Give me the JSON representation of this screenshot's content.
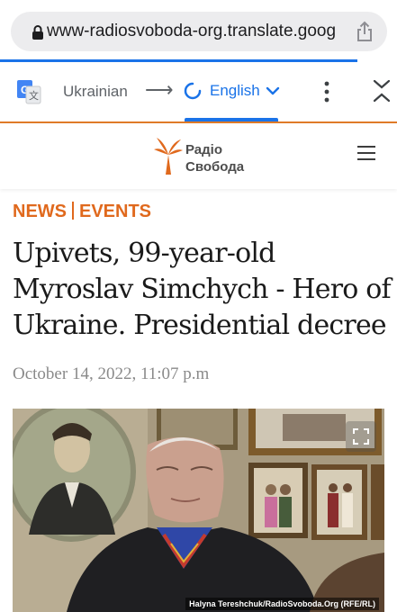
{
  "browser": {
    "url": "www-radiosvoboda-org.translate.goog"
  },
  "translate": {
    "source_language": "Ukrainian",
    "arrow": "⟶",
    "target_language": "English"
  },
  "site": {
    "logo_line1": "Радіо",
    "logo_line2": "Свобода",
    "accent_color": "#e0691d"
  },
  "article": {
    "category_left": "NEWS",
    "category_right": "EVENTS",
    "headline": "Upivets, 99-year-old Myroslav Simchych - Hero of Ukraine. Presidential decree",
    "date": "October 14, 2022, 11:07 p.m",
    "photo_credit": "Halyna Tereshchuk/RadioSvoboda.Org (RFE/RL)"
  },
  "colors": {
    "link_blue": "#1a73e8",
    "url_bar_bg": "#ececee"
  }
}
